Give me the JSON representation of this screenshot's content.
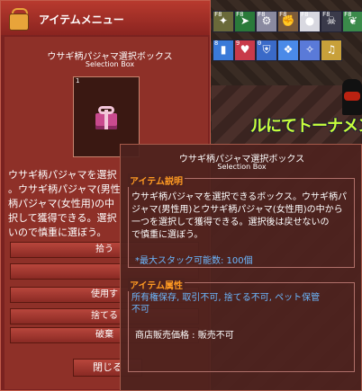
{
  "hud": {
    "arena_text": "ルにてトーナメン"
  },
  "skillbar": {
    "row1": [
      {
        "key": "F8",
        "icon": "staff-skill-icon",
        "color": "#6a6a3a",
        "glyph": "✦"
      },
      {
        "key": "F8",
        "icon": "green-arrow-skill-icon",
        "color": "#2a7a3a",
        "glyph": "➤"
      },
      {
        "key": "F8",
        "icon": "gear-skill-icon",
        "color": "#8a8aa0",
        "glyph": "⚙"
      },
      {
        "key": "F8",
        "icon": "fist-skill-icon",
        "color": "#7a5a3a",
        "glyph": "✊"
      },
      {
        "key": "F8",
        "icon": "white-orb-skill-icon",
        "color": "#d8d8e0",
        "glyph": "●"
      },
      {
        "key": "F8",
        "icon": "skull-skill-icon",
        "color": "#3a3a4a",
        "glyph": "☠"
      },
      {
        "key": "F8",
        "icon": "leaf-skill-icon",
        "color": "#3a8a4a",
        "glyph": "❦"
      }
    ],
    "row2": [
      {
        "key": "8",
        "icon": "blue-pillar-skill-icon",
        "color": "#3a7ad8",
        "glyph": "▮"
      },
      {
        "key": "9",
        "icon": "heart-skill-icon",
        "color": "#c83a4a",
        "glyph": "♥"
      },
      {
        "key": "0",
        "icon": "shield-skill-icon",
        "color": "#3a6ac8",
        "glyph": "⛨"
      },
      {
        "key": "",
        "icon": "wing-skill-icon",
        "color": "#4a8ae8",
        "glyph": "❖"
      },
      {
        "key": "",
        "icon": "blade-skill-icon",
        "color": "#5a7ad8",
        "glyph": "✧"
      },
      {
        "key": "",
        "icon": "lute-skill-icon",
        "color": "#c8a03a",
        "glyph": "♫"
      }
    ]
  },
  "window": {
    "title": "アイテムメニュー",
    "item_name": "ウサギ柄パジャマ選択ボックス",
    "item_subtitle": "Selection Box",
    "item_count": "1",
    "description": [
      "ウサギ柄パジャマを選択",
      "。ウサギ柄パジャマ(男性",
      "柄パジャマ(女性用)の中",
      "択して獲得できる。選択",
      "いので慎重に選ぼう。"
    ],
    "buttons": {
      "pickup": "拾う",
      "pickup2": "",
      "use": "使用す",
      "discard": "捨てる",
      "destroy": "破棄",
      "close": "閉じる"
    }
  },
  "tooltip": {
    "name": "ウサギ柄パジャマ選択ボックス",
    "subtitle": "Selection Box",
    "desc_header": "アイテム説明",
    "desc_lines": [
      "ウサギ柄パジャマを選択できるボックス。ウサギ柄パ",
      "ジャマ(男性用)とウサギ柄パジャマ(女性用)の中から",
      "一つを選択して獲得できる。選択後は戻せないの",
      "で慎重に選ぼう。"
    ],
    "max_stack": "*最大スタック可能数: 100個",
    "attr_header": "アイテム属性",
    "attr_lines": [
      "所有権保存, 取引不可, 捨てる不可, ペット保管",
      "不可"
    ],
    "shop": "商店販売価格 : 販売不可"
  }
}
